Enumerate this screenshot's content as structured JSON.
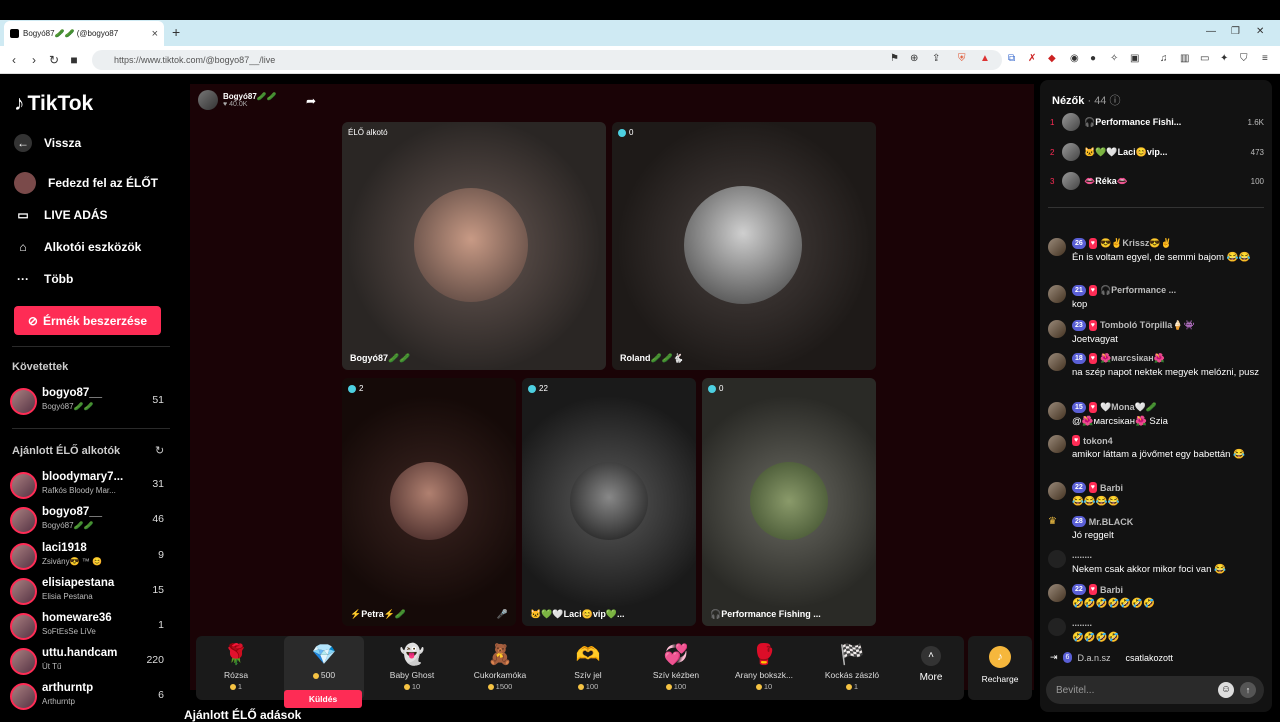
{
  "browser": {
    "tab_title": "Bogyó87🥒🥒 (@bogyo87",
    "url": "https://www.tiktok.com/@bogyo87__/live"
  },
  "sidebar": {
    "logo": "TikTok",
    "nav": [
      {
        "label": "Vissza",
        "icon": "back-arrow-icon"
      },
      {
        "label": "Fedezd fel az ÉLŐT",
        "icon": "explore-live-icon"
      },
      {
        "label": "LIVE ADÁS",
        "icon": "camera-icon"
      },
      {
        "label": "Alkotói eszközök",
        "icon": "creator-tools-icon"
      },
      {
        "label": "Több",
        "icon": "more-dots-icon"
      }
    ],
    "coin_button": "Érmék beszerzése",
    "following_title": "Követettek",
    "following": [
      {
        "name": "bogyo87__",
        "sub": "Bogyó87🥒🥒",
        "count": "51"
      }
    ],
    "recommended_title": "Ajánlott ÉLŐ alkotók",
    "recommended": [
      {
        "name": "bloodymary7...",
        "sub": "Rafkós Bloody Mar...",
        "count": "31"
      },
      {
        "name": "bogyo87__",
        "sub": "Bogyó87🥒🥒",
        "count": "46"
      },
      {
        "name": "laci1918",
        "sub": "Zsivány😎 ™ 😊",
        "count": "9"
      },
      {
        "name": "elisiapestana",
        "sub": "Elisia Pestana",
        "count": "15"
      },
      {
        "name": "homeware36",
        "sub": "SoFtEsSe LiVe",
        "count": "1"
      },
      {
        "name": "uttu.handcam",
        "sub": "Út Tű",
        "count": "220"
      },
      {
        "name": "arthurntp",
        "sub": "Arthurntp",
        "count": "6"
      }
    ]
  },
  "stream": {
    "host_name": "Bogyó87🥒🥒",
    "host_likes": "♥ 40.0K",
    "tiles": [
      {
        "top_label": "ÉLŐ alkotó",
        "bottom_label": "Bogyó87🥒🥒"
      },
      {
        "top_label": "0",
        "bottom_label": "Roland🥒🥒🐇"
      },
      {
        "top_label": "2",
        "bottom_label": "⚡Petra⚡🥒"
      },
      {
        "top_label": "22",
        "bottom_label": "🐱💚🤍Laci😊vip💚..."
      },
      {
        "top_label": "0",
        "bottom_label": "🎧Performance Fishing ..."
      }
    ],
    "recommended_title": "Ajánlott ÉLŐ adások"
  },
  "gifts": [
    {
      "name": "Rózsa",
      "price": "1",
      "icon": "🌹"
    },
    {
      "name": "",
      "price": "500",
      "icon": "💎",
      "selected": true,
      "send_label": "Küldés"
    },
    {
      "name": "Baby Ghost",
      "price": "10",
      "icon": "👻"
    },
    {
      "name": "Cukorkamóka",
      "price": "1500",
      "icon": "🧸"
    },
    {
      "name": "Szív jel",
      "price": "100",
      "icon": "🫶"
    },
    {
      "name": "Szív kézben",
      "price": "100",
      "icon": "💞"
    },
    {
      "name": "Arany bokszk...",
      "price": "10",
      "icon": "🥊"
    },
    {
      "name": "Kockás zászló",
      "price": "1",
      "icon": "🏁"
    }
  ],
  "more_label": "More",
  "recharge_label": "Recharge",
  "chat": {
    "viewers_title": "Nézők",
    "viewers_count": "· 44",
    "top_viewers": [
      {
        "rank": "1",
        "name": "🎧Performance Fishi...",
        "score": "1.6K"
      },
      {
        "rank": "2",
        "name": "🐱💚🤍Laci😊vip...",
        "score": "473"
      },
      {
        "rank": "3",
        "name": "👄Réka👄",
        "score": "100"
      }
    ],
    "messages": [
      {
        "level": "26",
        "user": "😎✌Krissz😎✌",
        "text": "Én is voltam egyel, de semmi bajom 😂😂"
      },
      {
        "level": "21",
        "user": "🎧Performance ...",
        "text": "kop"
      },
      {
        "level": "23",
        "user": "Tomboló Törpilla🍦👾",
        "text": "Joetvagyat"
      },
      {
        "level": "18",
        "user": "🌺маrcsікан🌺",
        "text": "na szép napot nektek megyek melózni, pusz"
      },
      {
        "level": "15",
        "user": "🤍Mona🤍🥒",
        "text": "@🌺маrcsікан🌺 Szia"
      },
      {
        "level": "",
        "user": "tokon4",
        "text": "amikor láttam a jövőmet egy babettán 😂"
      },
      {
        "level": "22",
        "user": "Barbi",
        "text": "😂😂😂😂"
      },
      {
        "level": "28",
        "user": "Mr.BLACK",
        "text": "Jó reggelt"
      },
      {
        "level": "",
        "user": "........",
        "text": "Nekem csak akkor mikor foci van 😂"
      },
      {
        "level": "22",
        "user": "Barbi",
        "text": "🤣🤣🤣🤣🤣🤣🤣"
      },
      {
        "level": "",
        "user": "........",
        "text": "🤣🤣🤣🤣"
      }
    ],
    "joined_level": "6",
    "joined_user": "D.a.n.sz",
    "joined_text": "csatlakozott",
    "input_placeholder": "Bevitel..."
  }
}
